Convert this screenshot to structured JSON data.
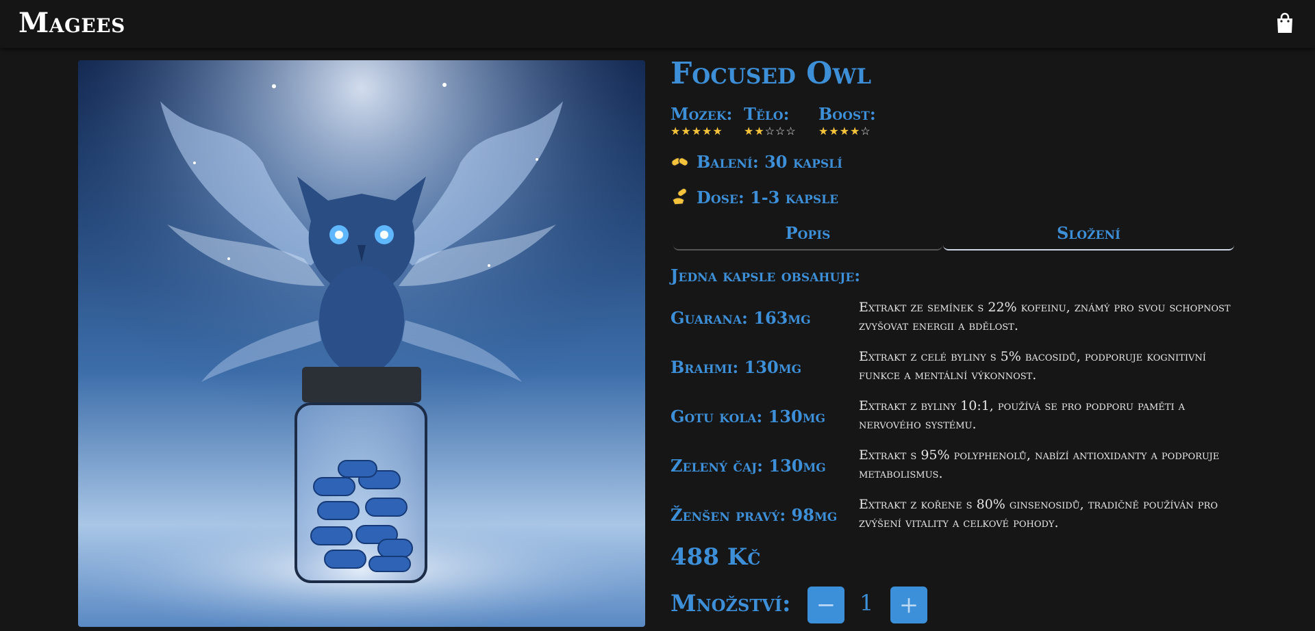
{
  "header": {
    "brand": "Magees",
    "cart_icon": "shopping-bag-icon"
  },
  "product": {
    "name": "Focused Owl",
    "image_alt": "Modrá sova nad lahvičkou s kapslemi",
    "ratings": [
      {
        "label": "Mozek:",
        "stars": 5
      },
      {
        "label": "Tělo:",
        "stars": 2
      },
      {
        "label": "Boost:",
        "stars": 4
      }
    ],
    "packaging": {
      "icon": "capsules-icon",
      "text": "Balení: 30 kapslí"
    },
    "dose": {
      "icon": "pill-hand-icon",
      "text": "Dose: 1-3 kapsle"
    },
    "tabs": [
      {
        "label": "Popis",
        "active": false
      },
      {
        "label": "Složení",
        "active": true
      }
    ],
    "composition": {
      "heading": "Jedna kapsle obsahuje:",
      "ingredients": [
        {
          "name": "Guarana: 163mg",
          "description": "Extrakt ze semínek s 22% kofeinu, známý pro svou schopnost zvyšovat energii a bdělost."
        },
        {
          "name": "Brahmi: 130mg",
          "description": "Extrakt z celé byliny s 5% bacosidů, podporuje kognitivní funkce a mentální výkonnost."
        },
        {
          "name": "Gotu kola: 130mg",
          "description": "Extrakt z byliny 10:1, používá se pro podporu paměti a nervového systému."
        },
        {
          "name": "Zelený čaj: 130mg",
          "description": "Extrakt s 95% polyphenolů, nabízí antioxidanty a podporuje metabolismus."
        },
        {
          "name": "Ženšen pravý: 98mg",
          "description": "Extrakt z kořene s 80% ginsenosidů, tradičně používán pro zvýšení vitality a celkové pohody."
        }
      ]
    },
    "price": "488 Kč",
    "quantity": {
      "label": "Množství:",
      "value": "1",
      "minus": "−",
      "plus": "+"
    }
  },
  "colors": {
    "accent": "#3d8fd8",
    "star": "#f5c33b",
    "background": "#161616",
    "button": "#3c8fd9"
  }
}
